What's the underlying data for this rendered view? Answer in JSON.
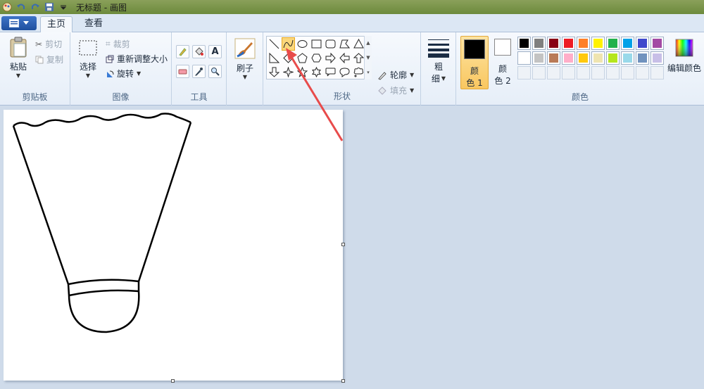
{
  "window": {
    "title": "无标题 - 画图"
  },
  "tabs": [
    {
      "label": "主页",
      "active": true
    },
    {
      "label": "查看",
      "active": false
    }
  ],
  "clipboard": {
    "paste": "粘贴",
    "cut": "剪切",
    "copy": "复制",
    "group_label": "剪贴板"
  },
  "image": {
    "select": "选择",
    "crop": "裁剪",
    "resize": "重新调整大小",
    "rotate": "旋转",
    "group_label": "图像"
  },
  "tools": {
    "group_label": "工具",
    "text_tool_glyph": "A"
  },
  "brush": {
    "label": "刷子"
  },
  "shapes": {
    "outline": "轮廓",
    "fill": "填充",
    "group_label": "形状",
    "selected_shape": "curve-icon"
  },
  "size": {
    "label_line1": "粗",
    "label_line2": "细"
  },
  "colors": {
    "color1": {
      "label_line1": "颜",
      "label_line2": "色 1",
      "value": "#000000"
    },
    "color2": {
      "label_line1": "颜",
      "label_line2": "色 2",
      "value": "#ffffff"
    },
    "edit": "编辑颜色",
    "group_label": "颜色",
    "palette_row1": [
      "#000000",
      "#7f7f7f",
      "#880015",
      "#ed1c24",
      "#ff7f27",
      "#fff200",
      "#22b14c",
      "#00a2e8",
      "#3f48cc",
      "#a349a4"
    ],
    "palette_row2": [
      "#ffffff",
      "#c3c3c3",
      "#b97a57",
      "#ffaec9",
      "#ffc90e",
      "#efe4b0",
      "#b5e61d",
      "#99d9ea",
      "#7092be",
      "#c8bfe7"
    ]
  },
  "accent": {
    "annotation_arrow": "#e84b4b",
    "selected_highlight": "#fbd77b"
  }
}
